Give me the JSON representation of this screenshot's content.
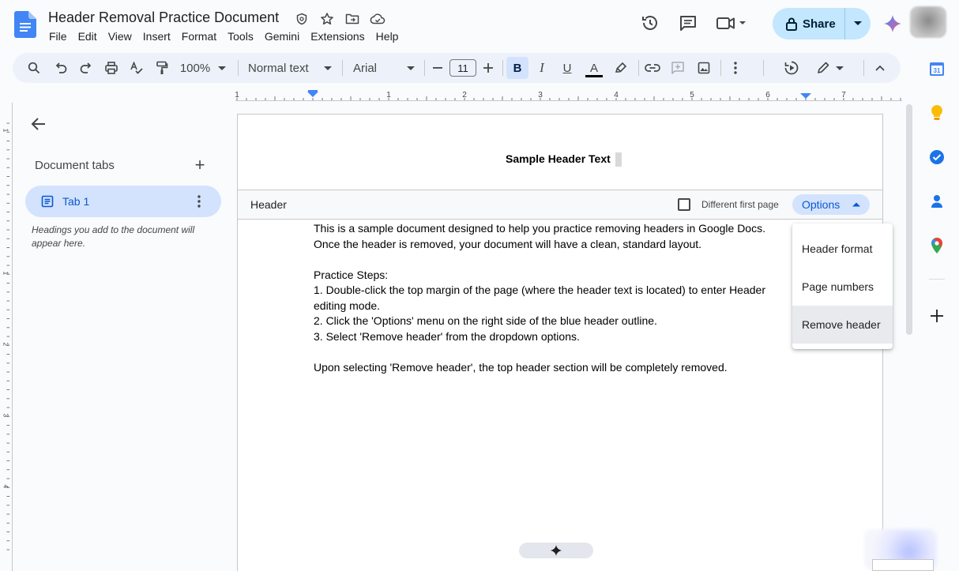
{
  "window": {
    "title": "Header Removal Practice Document"
  },
  "menubar": {
    "items": [
      "File",
      "Edit",
      "View",
      "Insert",
      "Format",
      "Tools",
      "Gemini",
      "Extensions",
      "Help"
    ]
  },
  "share": {
    "label": "Share"
  },
  "toolbar": {
    "zoom": "100%",
    "style": "Normal text",
    "font": "Arial",
    "font_size": "11",
    "bold_label": "B",
    "italic_label": "I",
    "underline_label": "U",
    "text_color_label": "A"
  },
  "ruler": {
    "labels": [
      "1",
      "1",
      "2",
      "3",
      "4",
      "5",
      "6",
      "7"
    ],
    "vertical_labels": [
      "1",
      "1",
      "2",
      "3",
      "4"
    ]
  },
  "left_panel": {
    "title": "Document tabs",
    "tab_label": "Tab 1",
    "headings_note": "Headings you add to the document will appear here."
  },
  "document": {
    "header_text": "Sample Header Text",
    "header_bar_label": "Header",
    "different_first_page": "Different first page",
    "options_label": "Options",
    "paragraphs": [
      "This is a sample document designed to help you practice removing headers in Google Docs.",
      "Once the header is removed, your document will have a clean, standard layout.",
      "",
      "Practice Steps:",
      "1. Double-click the top margin of the page (where the header text is located) to enter Header",
      "editing mode.",
      "2. Click the 'Options' menu on the right side of the blue header outline.",
      "3. Select 'Remove header' from the dropdown options.",
      "",
      "Upon selecting 'Remove header', the top header section will be completely removed."
    ]
  },
  "options_menu": {
    "items": [
      "Header format",
      "Page numbers",
      "Remove header"
    ],
    "hovered": "Remove header"
  },
  "side_panel": {
    "calendar_day": "31"
  },
  "colors": {
    "accent": "#0b57d0",
    "share_bg": "#c2e7ff",
    "tab_active_bg": "#d3e3fd",
    "toolbar_bg": "#edf2fa"
  }
}
